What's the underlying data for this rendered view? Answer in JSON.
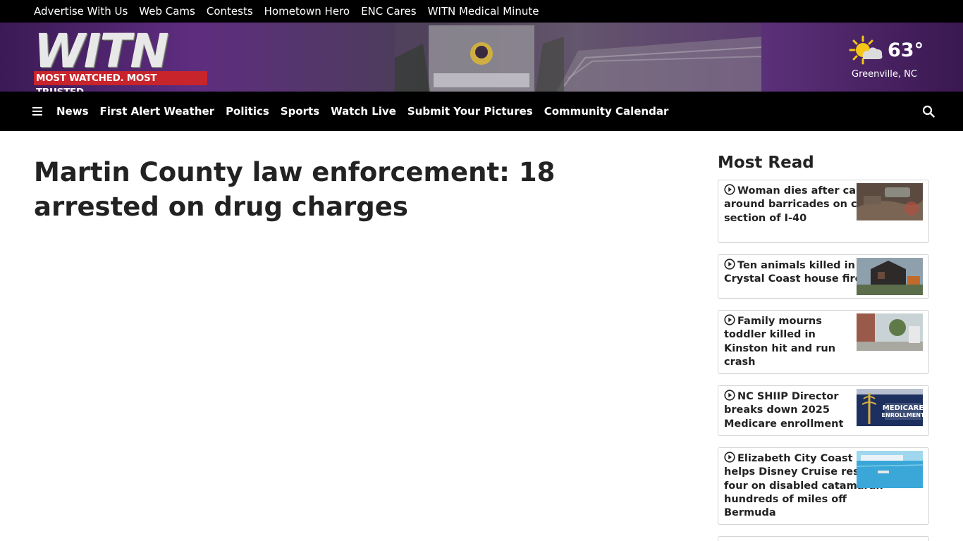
{
  "topbar": {
    "links": [
      "Advertise With Us",
      "Web Cams",
      "Contests",
      "Hometown Hero",
      "ENC Cares",
      "WITN Medical Minute"
    ]
  },
  "header": {
    "logo_text": "WITN",
    "logo_tagline": "MOST WATCHED. MOST TRUSTED.",
    "weather": {
      "temp": "63°",
      "location": "Greenville, NC",
      "icon": "sun-cloud-icon"
    }
  },
  "nav": {
    "items": [
      "News",
      "First Alert Weather",
      "Politics",
      "Sports",
      "Watch Live",
      "Submit Your Pictures",
      "Community Calendar"
    ]
  },
  "article": {
    "headline": "Martin County law enforcement: 18 arrested on drug charges"
  },
  "most_read": {
    "title": "Most Read",
    "stories": [
      {
        "title": "Woman dies after car goes around barricades on closed section of I-40"
      },
      {
        "title": "Ten animals killed in Crystal Coast house fire"
      },
      {
        "title": "Family mourns toddler killed in Kinston hit and run crash"
      },
      {
        "title": "NC SHIIP Director breaks down 2025 Medicare enrollment",
        "thumb_text": [
          "MEDICARE",
          "ENROLLMENT"
        ]
      },
      {
        "title": "Elizabeth City Coast Guard helps Disney Cruise rescue four on disabled catamaran hundreds of miles off Bermuda"
      }
    ]
  },
  "colors": {
    "brand_red": "#c8242b",
    "banner_purple": "#5e2d80",
    "nav_black": "#000000"
  }
}
